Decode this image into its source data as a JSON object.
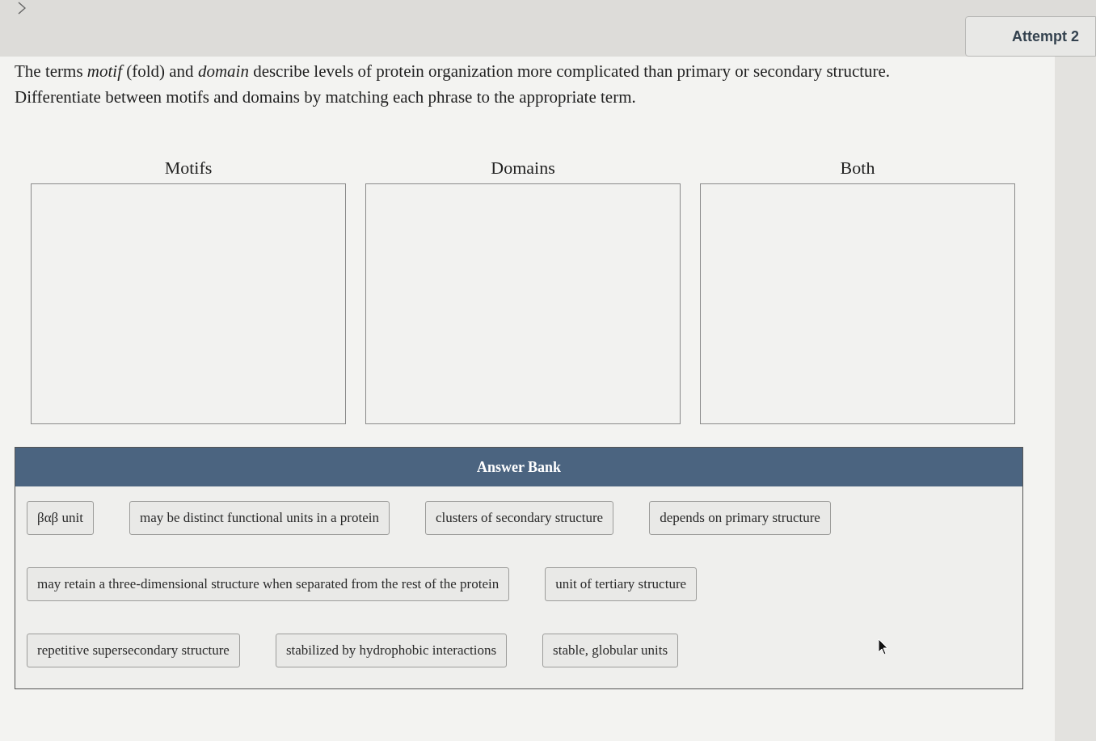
{
  "attempt": {
    "label": "Attempt 2"
  },
  "question": {
    "text": "The terms *motif* (fold) and *domain* describe levels of protein organization more complicated than primary or secondary structure. Differentiate between motifs and domains by matching each phrase to the appropriate term."
  },
  "bins": [
    {
      "label": "Motifs"
    },
    {
      "label": "Domains"
    },
    {
      "label": "Both"
    }
  ],
  "answer_bank": {
    "title": "Answer Bank",
    "rows": [
      [
        "βαβ unit",
        "may be distinct functional units in a protein",
        "clusters of secondary structure",
        "depends on primary structure"
      ],
      [
        "may retain a three-dimensional structure when separated from the rest of the protein",
        "unit of tertiary structure"
      ],
      [
        "repetitive supersecondary structure",
        "stabilized by hydrophobic interactions",
        "stable, globular units"
      ]
    ]
  }
}
